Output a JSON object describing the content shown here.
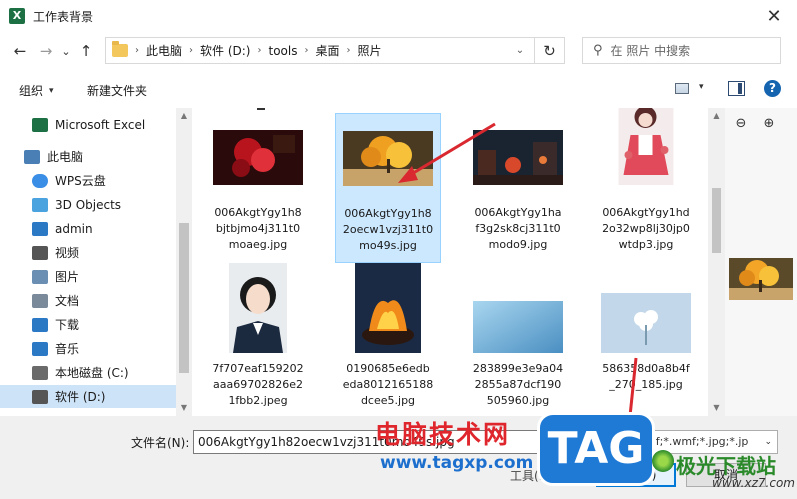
{
  "window": {
    "title": "工作表背景",
    "app_icon_letter": "X",
    "close_glyph": "✕"
  },
  "nav": {
    "back_glyph": "←",
    "forward_glyph": "→",
    "recent_glyph": "⌄",
    "up_glyph": "↑",
    "breadcrumbs": [
      "此电脑",
      "软件 (D:)",
      "tools",
      "桌面",
      "照片"
    ],
    "separator": "›",
    "dropdown_glyph": "⌄",
    "refresh_glyph": "↻",
    "search_placeholder": "在 照片 中搜索",
    "search_glyph": "⚲"
  },
  "toolbar": {
    "organize_label": "组织",
    "new_folder_label": "新建文件夹",
    "caret": "▾",
    "help_glyph": "?"
  },
  "sidebar": {
    "items": [
      {
        "label": "Microsoft Excel",
        "icon": "excel-icon",
        "color": "#1d7044",
        "indent": 2,
        "selected": false
      },
      {
        "label": "此电脑",
        "icon": "computer-icon",
        "color": "#4a7fb5",
        "indent": 1,
        "selected": false
      },
      {
        "label": "WPS云盘",
        "icon": "cloud-icon",
        "color": "#3a8ee6",
        "indent": 2,
        "selected": false
      },
      {
        "label": "3D Objects",
        "icon": "cube-icon",
        "color": "#4aa3df",
        "indent": 2,
        "selected": false
      },
      {
        "label": "admin",
        "icon": "user-folder-icon",
        "color": "#2b78c5",
        "indent": 2,
        "selected": false
      },
      {
        "label": "视频",
        "icon": "video-icon",
        "color": "#555555",
        "indent": 2,
        "selected": false
      },
      {
        "label": "图片",
        "icon": "pictures-icon",
        "color": "#6b8fb3",
        "indent": 2,
        "selected": false
      },
      {
        "label": "文档",
        "icon": "documents-icon",
        "color": "#7a8a9a",
        "indent": 2,
        "selected": false
      },
      {
        "label": "下载",
        "icon": "download-icon",
        "color": "#2b78c5",
        "indent": 2,
        "selected": false
      },
      {
        "label": "音乐",
        "icon": "music-icon",
        "color": "#2b78c5",
        "indent": 2,
        "selected": false
      },
      {
        "label": "本地磁盘 (C:)",
        "icon": "drive-c-icon",
        "color": "#6a6a6a",
        "indent": 2,
        "selected": false
      },
      {
        "label": "软件 (D:)",
        "icon": "drive-d-icon",
        "color": "#555555",
        "indent": 2,
        "selected": true
      }
    ],
    "scroll_up": "▲",
    "scroll_down": "▼"
  },
  "files": [
    {
      "name": "006AkgtYgy1h8bjtbjmo4j311t0moaeg.jpg",
      "lines": [
        "006AkgtYgy1h8",
        "bjtbjmo4j311t0",
        "moaeg.jpg"
      ],
      "thumb": "red-smoke",
      "selected": false
    },
    {
      "name": "006AkgtYgy1h82oecw1vzj311t0mo49s.jpg",
      "lines": [
        "006AkgtYgy1h8",
        "2oecw1vzj311t0",
        "mo49s.jpg"
      ],
      "thumb": "golden-tree",
      "selected": true
    },
    {
      "name": "006AkgtYgy1haf3g2sk8cj311t0modo9.jpg",
      "lines": [
        "006AkgtYgy1ha",
        "f3g2sk8cj311t0",
        "modo9.jpg"
      ],
      "thumb": "night-street",
      "selected": false
    },
    {
      "name": "006AkgtYgy1hd2o32wp8lj30jp0wtdp3.jpg",
      "lines": [
        "006AkgtYgy1hd",
        "2o32wp8lj30jp0",
        "wtdp3.jpg"
      ],
      "thumb": "anime-girl",
      "selected": false
    },
    {
      "name": "7f707eaf159202aaa69702826e21fbb2.jpeg",
      "lines": [
        "7f707eaf159202",
        "aaa69702826e2",
        "1fbb2.jpeg"
      ],
      "thumb": "portrait",
      "selected": false
    },
    {
      "name": "0190685e6edbeda8012165188dcee5.jpg",
      "lines": [
        "0190685e6edb",
        "eda8012165188",
        "dcee5.jpg"
      ],
      "thumb": "fire",
      "selected": false
    },
    {
      "name": "283899e3e9a042855a87dcf190505960.jpg",
      "lines": [
        "283899e3e9a04",
        "2855a87dcf190",
        "505960.jpg"
      ],
      "thumb": "blue-gradient",
      "selected": false
    },
    {
      "name": "586358d0a8b4f270_185.jpg",
      "lines": [
        "586358d0a8b4f",
        "_270_185.jpg"
      ],
      "thumb": "white-flower",
      "selected": false
    }
  ],
  "scrollbar": {
    "up": "▲",
    "down": "▼"
  },
  "preview": {
    "zoom_out": "⊖",
    "zoom_in": "⊕"
  },
  "bottom": {
    "filename_label": "文件名(N):",
    "filename_value": "006AkgtYgy1h82oecw1vzj311t0mo49s.jpg",
    "filter_value": "(*.emf;*.wmf;*.jpg;*.jp",
    "filter_caret": "⌄",
    "tools_label": "工具(L)  ▾",
    "insert_label": "插入(S)",
    "cancel_label": "取消"
  },
  "watermark": {
    "text": "电脑技术网",
    "url": "www.tagxp.com",
    "tag": "TAG",
    "site_cn": "极光下载站",
    "site_en": "www.xz7.com"
  },
  "colors": {
    "accent": "#0078d7",
    "selection": "#cce8ff",
    "arrow": "#d9282f"
  }
}
